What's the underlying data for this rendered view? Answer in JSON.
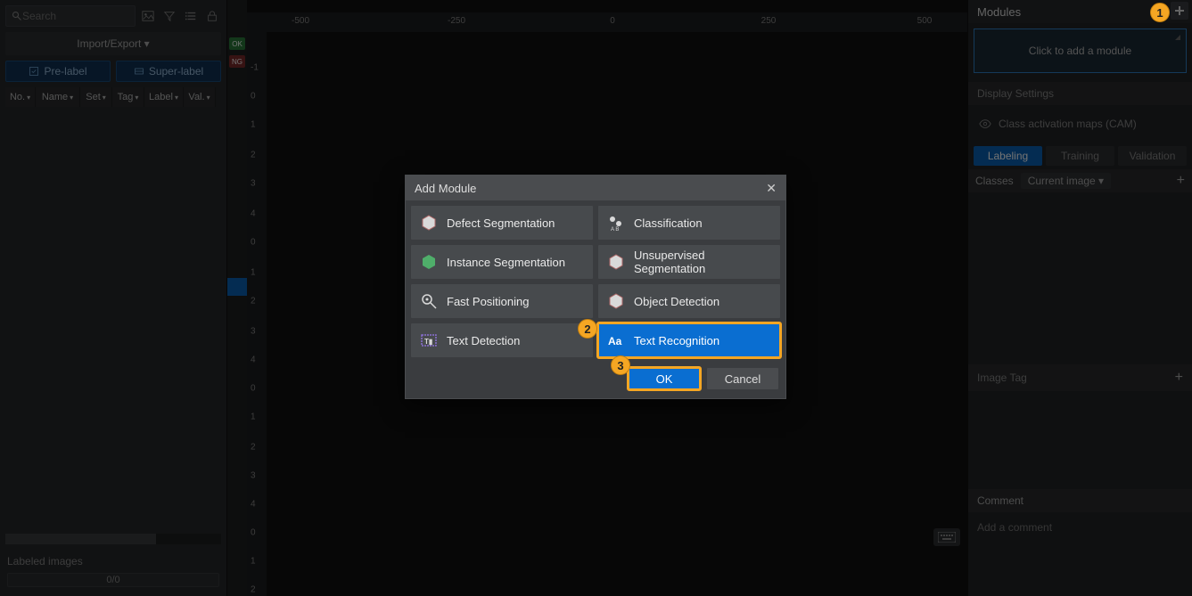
{
  "left": {
    "search_placeholder": "Search",
    "import_export": "Import/Export ▾",
    "prelabel": "Pre-label",
    "superlabel": "Super-label",
    "columns": [
      "No.",
      "Name",
      "Set",
      "Tag",
      "Label",
      "Val."
    ],
    "labeled_title": "Labeled images",
    "progress": "0/0"
  },
  "strip": {
    "ok": "OK",
    "ng": "NG"
  },
  "ruler": {
    "top": [
      {
        "pos": 60,
        "label": "-500"
      },
      {
        "pos": 235,
        "label": "-250"
      },
      {
        "pos": 410,
        "label": "0"
      },
      {
        "pos": 585,
        "label": "250"
      },
      {
        "pos": 760,
        "label": "500"
      }
    ],
    "left": [
      {
        "pos": 40,
        "label": "-1"
      },
      {
        "pos": 72,
        "label": "0"
      },
      {
        "pos": 104,
        "label": "1"
      },
      {
        "pos": 138,
        "label": "2"
      },
      {
        "pos": 170,
        "label": "3"
      },
      {
        "pos": 204,
        "label": "4"
      },
      {
        "pos": 236,
        "label": "0"
      },
      {
        "pos": 270,
        "label": "1"
      },
      {
        "pos": 302,
        "label": "2"
      },
      {
        "pos": 336,
        "label": "3"
      },
      {
        "pos": 368,
        "label": "4"
      },
      {
        "pos": 400,
        "label": "0"
      },
      {
        "pos": 432,
        "label": "1"
      },
      {
        "pos": 466,
        "label": "2"
      },
      {
        "pos": 498,
        "label": "3"
      },
      {
        "pos": 530,
        "label": "4"
      },
      {
        "pos": 562,
        "label": "0"
      },
      {
        "pos": 594,
        "label": "1"
      },
      {
        "pos": 626,
        "label": "2"
      }
    ]
  },
  "right": {
    "modules_title": "Modules",
    "click_to_add": "Click to add a module",
    "display_settings": "Display Settings",
    "cam": "Class activation maps (CAM)",
    "tabs": [
      "Labeling",
      "Training",
      "Validation"
    ],
    "classes": "Classes",
    "current_image": "Current image ▾",
    "image_tag": "Image Tag",
    "comment": "Comment",
    "comment_placeholder": "Add a comment"
  },
  "modal": {
    "title": "Add Module",
    "options": [
      {
        "id": "defect-segmentation",
        "label": "Defect Segmentation",
        "icon": "hex"
      },
      {
        "id": "classification",
        "label": "Classification",
        "icon": "tags"
      },
      {
        "id": "instance-segmentation",
        "label": "Instance Segmentation",
        "icon": "hex-green"
      },
      {
        "id": "unsupervised-segmentation",
        "label": "Unsupervised Segmentation",
        "icon": "hex"
      },
      {
        "id": "fast-positioning",
        "label": "Fast Positioning",
        "icon": "target"
      },
      {
        "id": "object-detection",
        "label": "Object Detection",
        "icon": "hex"
      },
      {
        "id": "text-detection",
        "label": "Text Detection",
        "icon": "text-box"
      },
      {
        "id": "text-recognition",
        "label": "Text Recognition",
        "icon": "aa",
        "selected": true
      }
    ],
    "ok": "OK",
    "cancel": "Cancel"
  },
  "callouts": {
    "1": "1",
    "2": "2",
    "3": "3"
  }
}
